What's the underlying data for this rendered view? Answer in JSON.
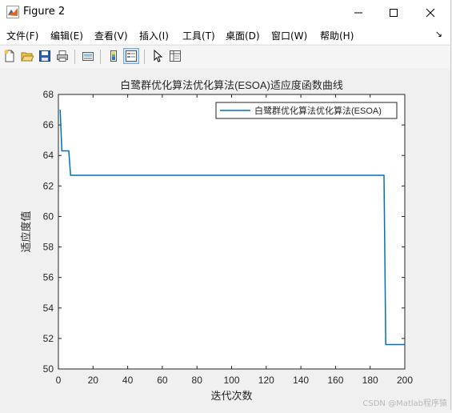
{
  "window": {
    "title": "Figure 2",
    "minimize_icon": "minimize-icon",
    "maximize_icon": "maximize-icon",
    "close_icon": "close-icon"
  },
  "menubar": {
    "items": [
      "文件(F)",
      "编辑(E)",
      "查看(V)",
      "插入(I)",
      "工具(T)",
      "桌面(D)",
      "窗口(W)",
      "帮助(H)"
    ],
    "overflow_icon": "chevron-right-icon"
  },
  "toolbar": {
    "icons": [
      "new-figure-icon",
      "open-file-icon",
      "save-icon",
      "print-icon",
      "link-icon",
      "colorbar-icon",
      "legend-icon",
      "pointer-icon",
      "property-editor-icon"
    ]
  },
  "chart_data": {
    "type": "line",
    "title": "白鹭群优化算法优化算法(ESOA)适应度函数曲线",
    "xlabel": "迭代次数",
    "ylabel": "适应度值",
    "xlim": [
      0,
      200
    ],
    "ylim": [
      50,
      68
    ],
    "xticks": [
      0,
      20,
      40,
      60,
      80,
      100,
      120,
      140,
      160,
      180,
      200
    ],
    "yticks": [
      50,
      52,
      54,
      56,
      58,
      60,
      62,
      64,
      66,
      68
    ],
    "legend": {
      "position": "top-right",
      "entries": [
        "白鹭群优化算法优化算法(ESOA)"
      ]
    },
    "grid": false,
    "series": [
      {
        "name": "白鹭群优化算法优化算法(ESOA)",
        "color": "#0072BD",
        "x": [
          1,
          2,
          3,
          4,
          5,
          6,
          7,
          8,
          187,
          188,
          189,
          200
        ],
        "y": [
          67.0,
          64.3,
          64.3,
          64.3,
          64.3,
          64.3,
          62.7,
          62.7,
          62.7,
          62.7,
          51.6,
          51.6
        ]
      }
    ]
  },
  "watermark": "CSDN @Matlab程序猿"
}
